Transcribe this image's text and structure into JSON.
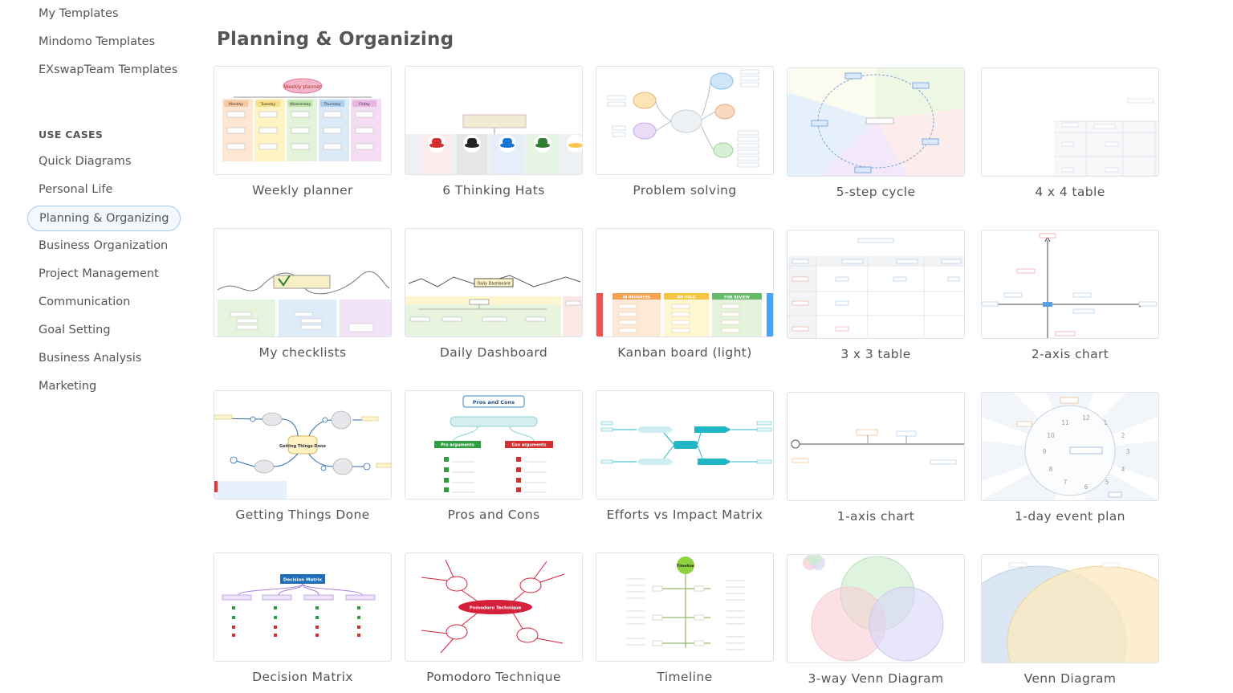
{
  "sidebar": {
    "my_templates": "My Templates",
    "mindomo_templates": "Mindomo Templates",
    "team_templates": "EXswapTeam Templates",
    "use_cases_heading": "USE CASES",
    "items": [
      "Quick Diagrams",
      "Personal Life",
      "Planning & Organizing",
      "Business Organization",
      "Project Management",
      "Communication",
      "Goal Setting",
      "Business Analysis",
      "Marketing"
    ],
    "active_item": "Planning & Organizing"
  },
  "main": {
    "title": "Planning & Organizing",
    "templates": [
      "Weekly planner",
      "6 Thinking Hats",
      "Problem solving",
      "5-step cycle",
      "4 x 4 table",
      "My checklists",
      "Daily Dashboard",
      "Kanban board (light)",
      "3 x 3 table",
      "2-axis chart",
      "Getting Things Done",
      "Pros and Cons",
      "Efforts vs Impact Matrix",
      "1-axis chart",
      "1-day event plan",
      "Decision Matrix",
      "Pomodoro Technique",
      "Timeline",
      "3-way Venn Diagram",
      "Venn Diagram"
    ]
  },
  "thumbnails": {
    "weekly_planner_days": [
      "Monday",
      "Tuesday",
      "Wednesday",
      "Thursday",
      "Friday"
    ],
    "weekly_planner_title": "Weekly planner",
    "daily_dashboard_title": "Daily Dashboard",
    "pros_cons": {
      "title": "Pros and Cons",
      "pros": "Pro arguments",
      "cons": "Con arguments"
    },
    "decision_matrix_title": "Decision Matrix",
    "pomodoro_title": "Pomodoro Technique",
    "timeline_title": "Timeline",
    "kanban_columns": [
      "IN PROGRESS",
      "ON HOLD",
      "FOR REVIEW"
    ],
    "gtd_center": "Getting Things Done",
    "clock_numbers": [
      "12",
      "1",
      "2",
      "3",
      "4",
      "5",
      "6",
      "7",
      "8",
      "9",
      "10",
      "11"
    ],
    "hats_colors": [
      "#d32f2f",
      "#222222",
      "#1976d2",
      "#2e7d32",
      "#f9c74f"
    ]
  }
}
